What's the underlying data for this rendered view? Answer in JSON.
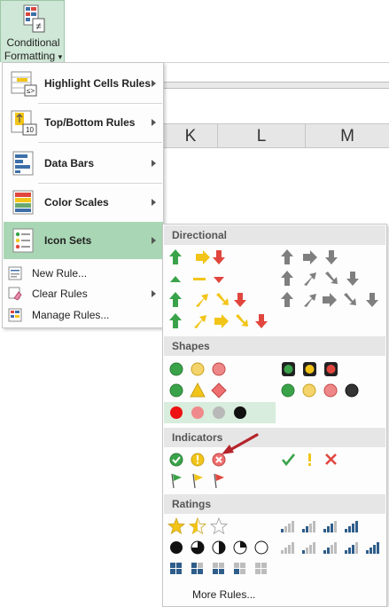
{
  "ribbon": {
    "button_line1": "Conditional",
    "button_line2": "Formatting",
    "button_caret": "▾"
  },
  "sheet": {
    "columns": [
      "K",
      "L",
      "M"
    ]
  },
  "main_menu": {
    "items": [
      {
        "name": "highlight-cells-rules",
        "label": "Highlight Cells Rules",
        "icon": "highlight-cells-icon"
      },
      {
        "name": "top-bottom-rules",
        "label": "Top/Bottom Rules",
        "icon": "top-bottom-icon"
      },
      {
        "name": "data-bars",
        "label": "Data Bars",
        "icon": "data-bars-icon"
      },
      {
        "name": "color-scales",
        "label": "Color Scales",
        "icon": "color-scales-icon"
      },
      {
        "name": "icon-sets",
        "label": "Icon Sets",
        "icon": "icon-sets-icon"
      }
    ],
    "small_items": [
      {
        "name": "new-rule",
        "label": "New Rule...",
        "icon": "new-rule-icon"
      },
      {
        "name": "clear-rules",
        "label": "Clear Rules",
        "icon": "clear-rules-icon"
      },
      {
        "name": "manage-rules",
        "label": "Manage Rules...",
        "icon": "manage-rules-icon"
      }
    ]
  },
  "icon_sets": {
    "sections": [
      "Directional",
      "Shapes",
      "Indicators",
      "Ratings"
    ],
    "more_rules": "More Rules..."
  },
  "colors": {
    "menu_highlight": "#a9d6b4",
    "ribbon_button": "#cfe7d6",
    "green": "#3aa34a",
    "yellow": "#f2c418",
    "red": "#e0463e",
    "gray": "#7f7f7f",
    "blue": "#2e5d8a",
    "callout_arrow": "#b5242a"
  }
}
